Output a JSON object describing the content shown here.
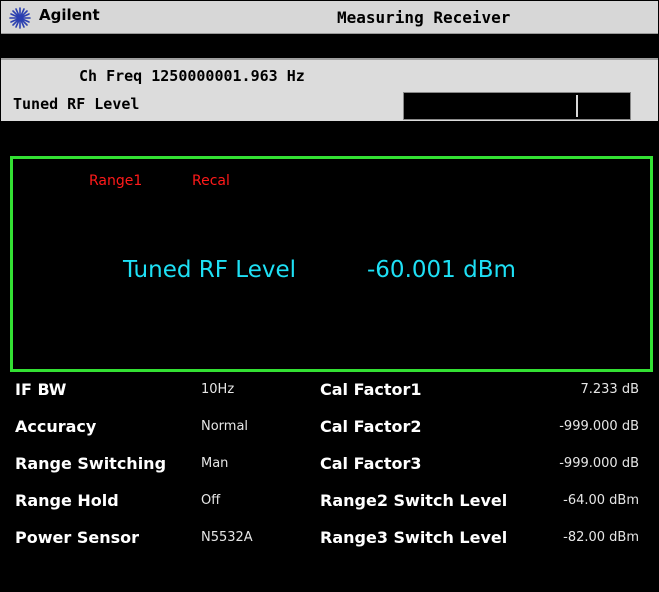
{
  "brand": "Agilent",
  "app_title": "Measuring Receiver",
  "channel_frequency": "Ch Freq 1250000001.963 Hz",
  "tuned_rf_level_label": "Tuned RF Level",
  "measurement": {
    "flags": [
      "Range1",
      "Recal"
    ],
    "label": "Tuned RF Level",
    "value": "-60.001 dBm"
  },
  "settings_left": [
    {
      "label": "IF BW",
      "value": "10Hz"
    },
    {
      "label": "Accuracy",
      "value": "Normal"
    },
    {
      "label": "Range Switching",
      "value": "Man"
    },
    {
      "label": "Range Hold",
      "value": "Off"
    },
    {
      "label": "Power Sensor",
      "value": "N5532A"
    }
  ],
  "settings_right": [
    {
      "label": "Cal Factor1",
      "value": "7.233 dB"
    },
    {
      "label": "Cal Factor2",
      "value": "-999.000 dB"
    },
    {
      "label": "Cal Factor3",
      "value": "-999.000 dB"
    },
    {
      "label": "Range2 Switch Level",
      "value": "-64.00 dBm"
    },
    {
      "label": "Range3 Switch Level",
      "value": "-82.00 dBm"
    }
  ],
  "colors": {
    "measurement_text": "#1ee0f5",
    "flag_text": "#ff1a1a",
    "panel_border": "#33e033",
    "background": "#000000",
    "title_bar": "#d7d7d7"
  },
  "icons": {
    "logo": "agilent-spark-icon"
  }
}
